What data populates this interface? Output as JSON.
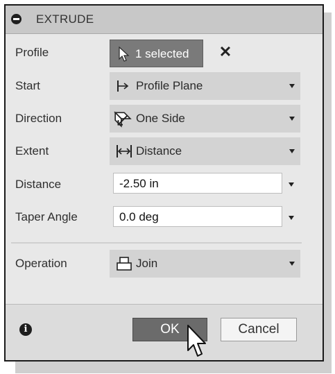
{
  "dialog": {
    "title": "EXTRUDE",
    "title_icon": "collapse-icon"
  },
  "rows": {
    "profile": {
      "label": "Profile",
      "value": "1 selected",
      "icon": "select-cursor-icon",
      "clear_icon": "close-icon"
    },
    "start": {
      "label": "Start",
      "value": "Profile Plane",
      "icon": "profile-plane-icon"
    },
    "direction": {
      "label": "Direction",
      "value": "One Side",
      "icon": "one-side-icon"
    },
    "extent": {
      "label": "Extent",
      "value": "Distance",
      "icon": "distance-icon"
    },
    "distance": {
      "label": "Distance",
      "value": "-2.50 in"
    },
    "taper_angle": {
      "label": "Taper Angle",
      "value": "0.0 deg"
    },
    "operation": {
      "label": "Operation",
      "value": "Join",
      "icon": "join-icon"
    }
  },
  "footer": {
    "info_icon": "info-icon",
    "ok_label": "OK",
    "cancel_label": "Cancel"
  },
  "colors": {
    "dialog_bg": "#e8e8e8",
    "field_bg": "#d3d3d3",
    "ok_button": "#6b6b6b",
    "selected_button": "#7a7a7a"
  }
}
